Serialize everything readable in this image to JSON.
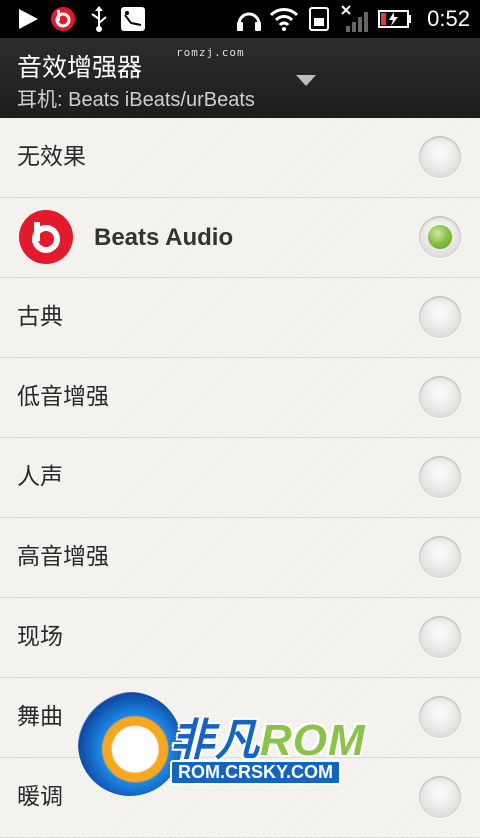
{
  "status_bar": {
    "time": "0:52",
    "icons": [
      "play-icon",
      "beats-icon",
      "usb-icon",
      "sd-icon",
      "headphones-icon",
      "wifi-icon",
      "sim-icon",
      "signal-icon",
      "battery-icon"
    ]
  },
  "header": {
    "title": "音效增强器",
    "subtitle": "耳机: Beats iBeats/urBeats",
    "watermark": "romzj.com"
  },
  "options": [
    {
      "label": "无效果",
      "selected": false
    },
    {
      "label": "Beats Audio",
      "selected": true
    },
    {
      "label": "古典",
      "selected": false
    },
    {
      "label": "低音增强",
      "selected": false
    },
    {
      "label": "人声",
      "selected": false
    },
    {
      "label": "高音增强",
      "selected": false
    },
    {
      "label": "现场",
      "selected": false
    },
    {
      "label": "舞曲",
      "selected": false
    },
    {
      "label": "暖调",
      "selected": false
    }
  ],
  "watermark_logo": {
    "main": "非凡",
    "rom": "ROM",
    "url": "ROM.CRSKY.COM"
  },
  "colors": {
    "accent_green": "#8bc34a",
    "beats_red": "#e21a2c",
    "header_bg": "#252525"
  }
}
